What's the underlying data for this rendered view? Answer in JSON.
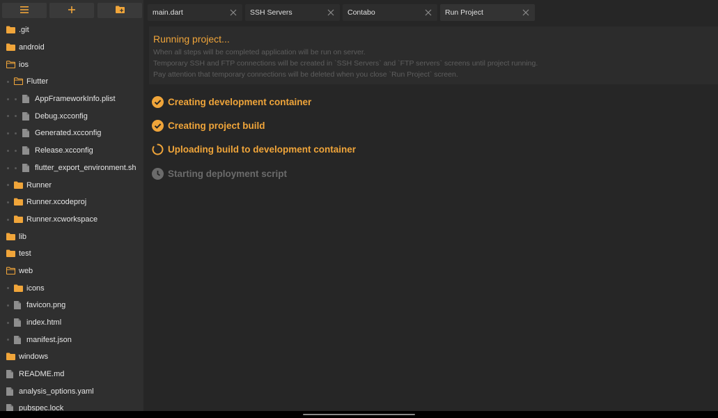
{
  "colors": {
    "accent": "#f0a53a",
    "folder": "#f0a53a",
    "muted": "#6b6b6b"
  },
  "sidebar": {
    "toolbar": [
      {
        "icon": "menu-icon"
      },
      {
        "icon": "plus-icon"
      },
      {
        "icon": "new-folder-icon"
      }
    ],
    "tree": [
      {
        "label": ".git",
        "type": "folder",
        "open": false,
        "depth": 0
      },
      {
        "label": "android",
        "type": "folder",
        "open": false,
        "depth": 0
      },
      {
        "label": "ios",
        "type": "folder",
        "open": true,
        "depth": 0
      },
      {
        "label": "Flutter",
        "type": "folder",
        "open": true,
        "depth": 1
      },
      {
        "label": "AppFrameworkInfo.plist",
        "type": "file",
        "depth": 2
      },
      {
        "label": "Debug.xcconfig",
        "type": "file",
        "depth": 2
      },
      {
        "label": "Generated.xcconfig",
        "type": "file",
        "depth": 2
      },
      {
        "label": "Release.xcconfig",
        "type": "file",
        "depth": 2
      },
      {
        "label": "flutter_export_environment.sh",
        "type": "file",
        "depth": 2
      },
      {
        "label": "Runner",
        "type": "folder",
        "open": false,
        "depth": 1
      },
      {
        "label": "Runner.xcodeproj",
        "type": "folder",
        "open": false,
        "depth": 1
      },
      {
        "label": "Runner.xcworkspace",
        "type": "folder",
        "open": false,
        "depth": 1
      },
      {
        "label": "lib",
        "type": "folder",
        "open": false,
        "depth": 0
      },
      {
        "label": "test",
        "type": "folder",
        "open": false,
        "depth": 0
      },
      {
        "label": "web",
        "type": "folder",
        "open": true,
        "depth": 0
      },
      {
        "label": "icons",
        "type": "folder",
        "open": false,
        "depth": 1
      },
      {
        "label": "favicon.png",
        "type": "file",
        "depth": 1
      },
      {
        "label": "index.html",
        "type": "file",
        "depth": 1
      },
      {
        "label": "manifest.json",
        "type": "file",
        "depth": 1
      },
      {
        "label": "windows",
        "type": "folder",
        "open": false,
        "depth": 0
      },
      {
        "label": "README.md",
        "type": "file",
        "depth": 0
      },
      {
        "label": "analysis_options.yaml",
        "type": "file",
        "depth": 0
      },
      {
        "label": "pubspec.lock",
        "type": "file",
        "depth": 0
      }
    ]
  },
  "tabs": [
    {
      "label": "main.dart",
      "active": false
    },
    {
      "label": "SSH Servers",
      "active": false
    },
    {
      "label": "Contabo",
      "active": false
    },
    {
      "label": "Run Project",
      "active": true
    }
  ],
  "info": {
    "title": "Running project...",
    "lines": [
      "When all steps will be completed application will be run on server.",
      "Temporary SSH and FTP connections will be created in `SSH Servers` and `FTP servers` screens until project running.",
      "Pay attention that temporary connections will be deleted when you close `Run Project` screen."
    ]
  },
  "steps": [
    {
      "label": "Creating development container",
      "status": "done",
      "icon": "check-circle-icon"
    },
    {
      "label": "Creating project build",
      "status": "done",
      "icon": "check-circle-icon"
    },
    {
      "label": "Uploading build to development container",
      "status": "progress",
      "icon": "spinner-icon"
    },
    {
      "label": "Starting deployment script",
      "status": "pending",
      "icon": "clock-icon"
    }
  ]
}
